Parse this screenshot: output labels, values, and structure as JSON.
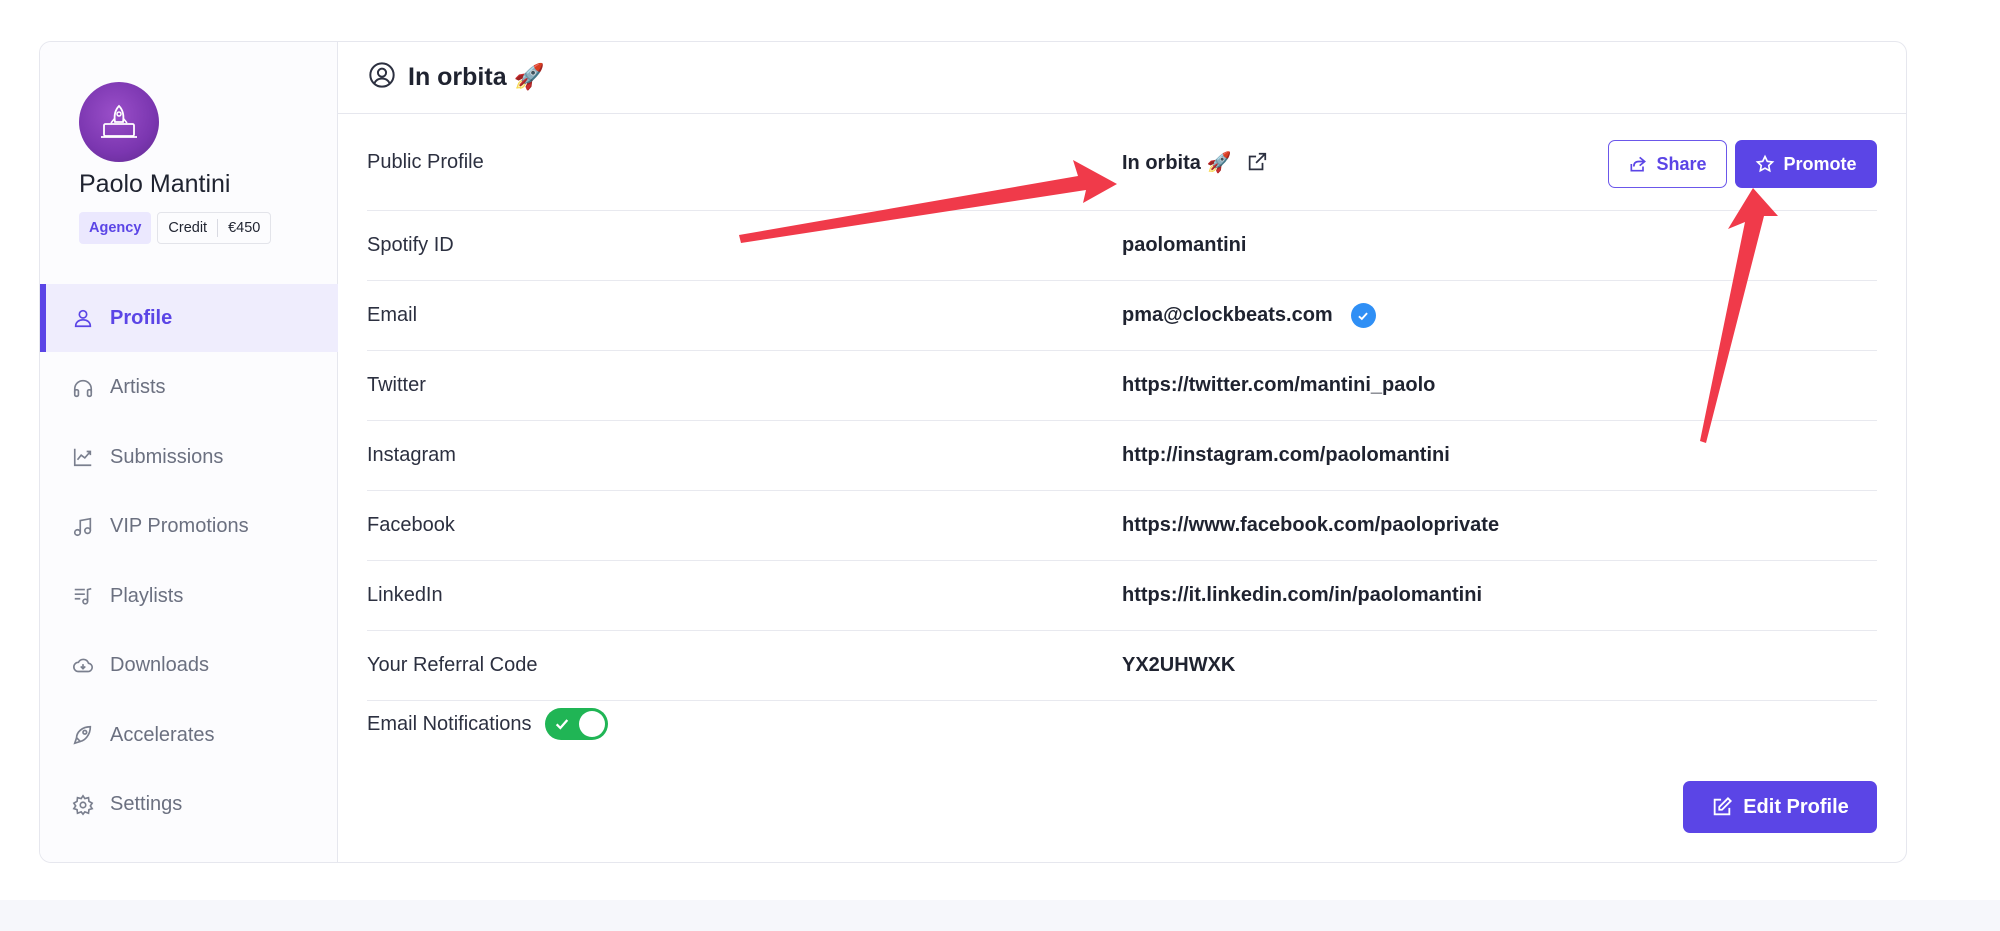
{
  "user": {
    "name": "Paolo Mantini",
    "role_badge": "Agency",
    "credit_label": "Credit",
    "credit_value": "€450"
  },
  "sidebar": {
    "items": [
      {
        "label": "Profile",
        "icon": "user-icon",
        "active": true
      },
      {
        "label": "Artists",
        "icon": "headphones-icon"
      },
      {
        "label": "Submissions",
        "icon": "chart-line-icon"
      },
      {
        "label": "VIP Promotions",
        "icon": "music-note-icon"
      },
      {
        "label": "Playlists",
        "icon": "playlist-icon"
      },
      {
        "label": "Downloads",
        "icon": "cloud-download-icon"
      },
      {
        "label": "Accelerates",
        "icon": "rocket-icon"
      },
      {
        "label": "Settings",
        "icon": "gear-icon"
      }
    ]
  },
  "header": {
    "title": "In orbita 🚀",
    "icon": "user-circle-icon"
  },
  "profile": {
    "public_profile_label": "Public Profile",
    "public_profile_value": "In orbita 🚀",
    "share_label": "Share",
    "promote_label": "Promote",
    "rows": [
      {
        "label": "Spotify ID",
        "value": "paolomantini"
      },
      {
        "label": "Email",
        "value": "pma@clockbeats.com",
        "verified": true
      },
      {
        "label": "Twitter",
        "value": "https://twitter.com/mantini_paolo"
      },
      {
        "label": "Instagram",
        "value": "http://instagram.com/paolomantini"
      },
      {
        "label": "Facebook",
        "value": "https://www.facebook.com/paoloprivate"
      },
      {
        "label": "LinkedIn",
        "value": "https://it.linkedin.com/in/paolomantini"
      },
      {
        "label": "Your Referral Code",
        "value": "YX2UHWXK"
      }
    ],
    "email_notifications_label": "Email Notifications",
    "email_notifications_on": true,
    "edit_label": "Edit Profile"
  },
  "colors": {
    "accent": "#5b45e6",
    "toggle_on": "#20b555",
    "verified": "#2f8ff5",
    "annotation_arrow": "#f03a4a"
  }
}
